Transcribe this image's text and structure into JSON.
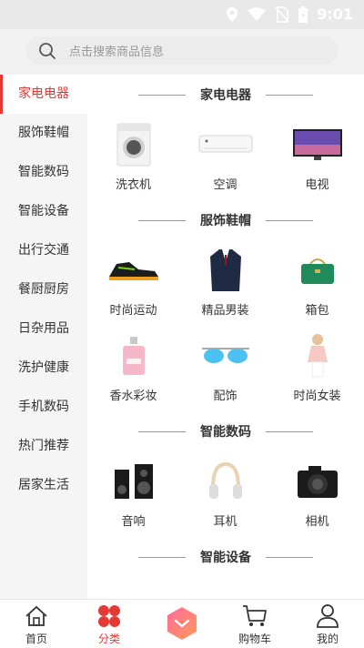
{
  "status_bar": {
    "time": "9:01"
  },
  "search": {
    "placeholder": "点击搜索商品信息"
  },
  "sidebar": {
    "items": [
      {
        "label": "家电电器",
        "active": true
      },
      {
        "label": "服饰鞋帽"
      },
      {
        "label": "智能数码"
      },
      {
        "label": "智能设备"
      },
      {
        "label": "出行交通"
      },
      {
        "label": "餐厨厨房"
      },
      {
        "label": "日杂用品"
      },
      {
        "label": "洗护健康"
      },
      {
        "label": "手机数码"
      },
      {
        "label": "热门推荐"
      },
      {
        "label": "居家生活"
      }
    ]
  },
  "sections": [
    {
      "title": "家电电器",
      "items": [
        {
          "label": "洗衣机",
          "icon": "washing-machine-icon"
        },
        {
          "label": "空调",
          "icon": "air-conditioner-icon"
        },
        {
          "label": "电视",
          "icon": "tv-icon"
        }
      ]
    },
    {
      "title": "服饰鞋帽",
      "items": [
        {
          "label": "时尚运动",
          "icon": "sneaker-icon"
        },
        {
          "label": "精品男装",
          "icon": "suit-icon"
        },
        {
          "label": "箱包",
          "icon": "handbag-icon"
        },
        {
          "label": "香水彩妆",
          "icon": "perfume-icon"
        },
        {
          "label": "配饰",
          "icon": "sunglasses-icon"
        },
        {
          "label": "时尚女装",
          "icon": "dress-icon"
        }
      ]
    },
    {
      "title": "智能数码",
      "items": [
        {
          "label": "音响",
          "icon": "speaker-icon"
        },
        {
          "label": "耳机",
          "icon": "headphones-icon"
        },
        {
          "label": "相机",
          "icon": "camera-icon"
        }
      ]
    },
    {
      "title": "智能设备",
      "items": []
    }
  ],
  "bottom_nav": {
    "items": [
      {
        "label": "首页",
        "icon": "home-icon"
      },
      {
        "label": "分类",
        "icon": "category-icon",
        "active": true
      },
      {
        "label": "",
        "icon": "center-chevron-icon"
      },
      {
        "label": "购物车",
        "icon": "cart-icon"
      },
      {
        "label": "我的",
        "icon": "user-icon"
      }
    ]
  },
  "colors": {
    "accent": "#e53935",
    "center_gradient_start": "#ff6b9a",
    "center_gradient_end": "#ff9a5a"
  }
}
